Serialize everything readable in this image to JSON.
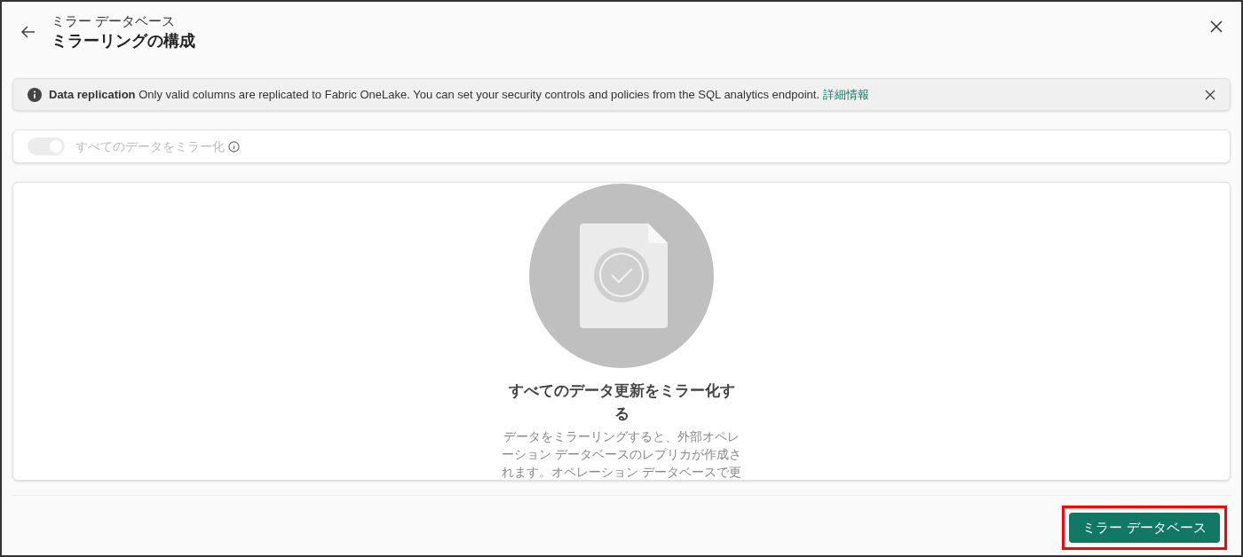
{
  "header": {
    "subtitle": "ミラー データベース",
    "title": "ミラーリングの構成"
  },
  "banner": {
    "title": "Data replication",
    "message": "Only valid columns are replicated to Fabric OneLake. You can set your security controls and policies from the SQL analytics endpoint.",
    "link": "詳細情報"
  },
  "toggle": {
    "label": "すべてのデータをミラー化",
    "on": true,
    "disabled": true
  },
  "empty_state": {
    "title": "すべてのデータ更新をミラー化する",
    "description_lines": [
      "データをミラーリングすると、外部オペレ",
      "ーション データベースのレプリカが作成さ",
      "れます。オペレーション データベースで更"
    ]
  },
  "footer": {
    "primary_button": {
      "label": "ミラー データベース",
      "highlighted": true
    }
  }
}
